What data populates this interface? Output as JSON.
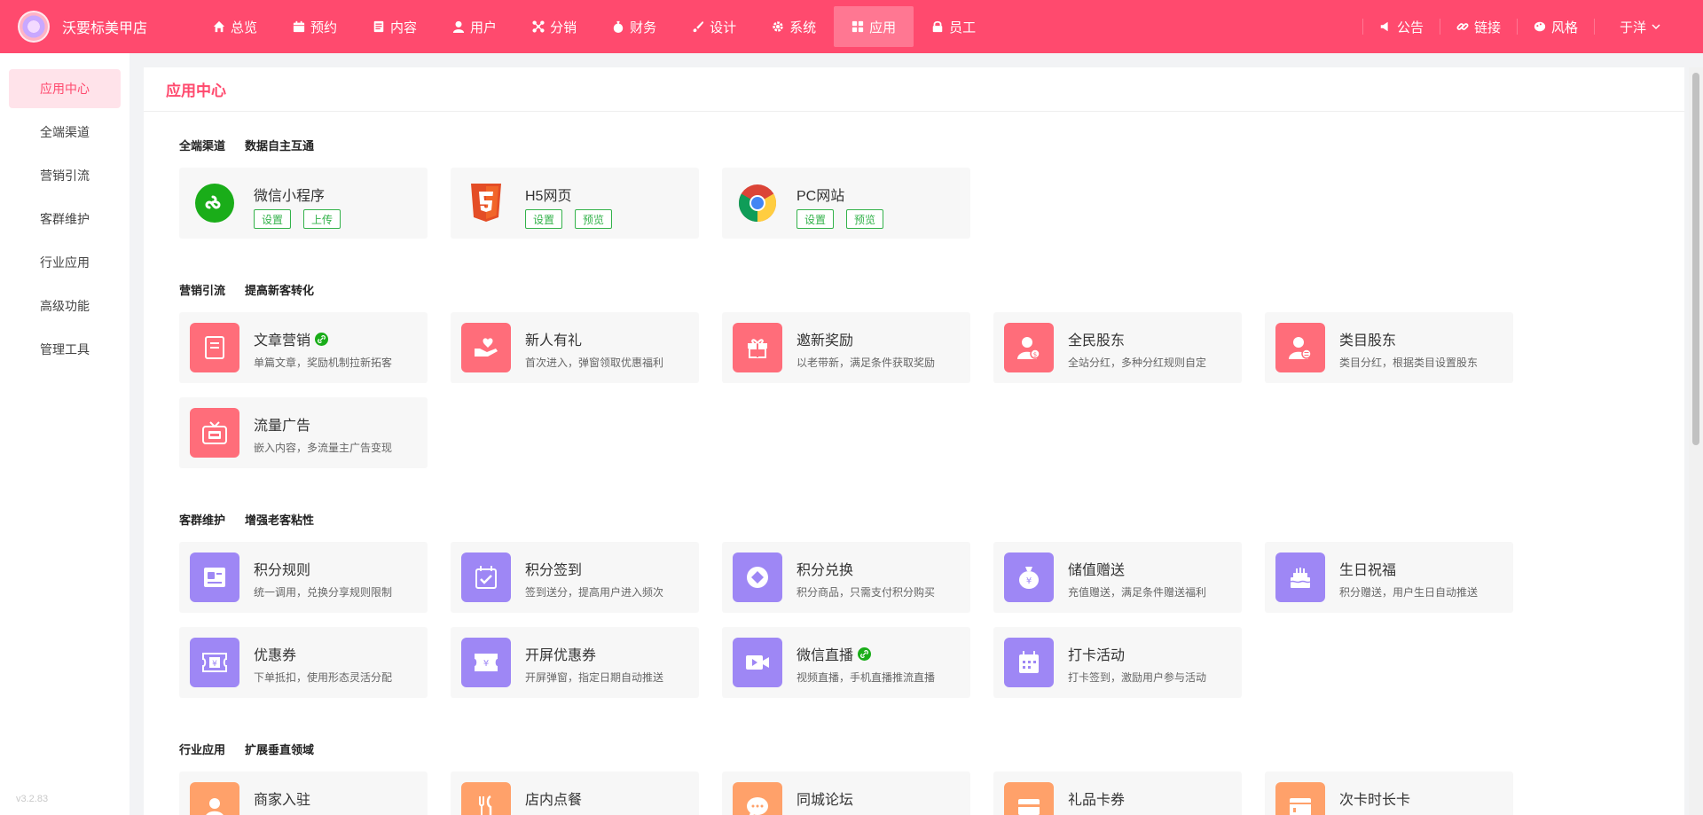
{
  "brand": {
    "name": "沃要标美甲店"
  },
  "nav": [
    {
      "label": "总览",
      "icon": "home-icon"
    },
    {
      "label": "预约",
      "icon": "calendar-icon"
    },
    {
      "label": "内容",
      "icon": "document-icon"
    },
    {
      "label": "用户",
      "icon": "user-icon"
    },
    {
      "label": "分销",
      "icon": "network-icon"
    },
    {
      "label": "财务",
      "icon": "money-bag-icon"
    },
    {
      "label": "设计",
      "icon": "brush-icon"
    },
    {
      "label": "系统",
      "icon": "gear-icon"
    },
    {
      "label": "应用",
      "icon": "grid-icon"
    },
    {
      "label": "员工",
      "icon": "lock-icon"
    }
  ],
  "nav_right": {
    "notice": "公告",
    "link": "链接",
    "style": "风格",
    "user": "于洋"
  },
  "sidebar": {
    "items": [
      {
        "label": "应用中心"
      },
      {
        "label": "全端渠道"
      },
      {
        "label": "营销引流"
      },
      {
        "label": "客群维护"
      },
      {
        "label": "行业应用"
      },
      {
        "label": "高级功能"
      },
      {
        "label": "管理工具"
      }
    ],
    "version": "v3.2.83"
  },
  "page_title": "应用中心",
  "sections": {
    "channel": {
      "title": "全端渠道",
      "subtitle": "数据自主互通",
      "cards": [
        {
          "title": "微信小程序",
          "btn1": "设置",
          "btn2": "上传",
          "icon": "wechat-miniprogram-icon"
        },
        {
          "title": "H5网页",
          "btn1": "设置",
          "btn2": "预览",
          "icon": "html5-icon"
        },
        {
          "title": "PC网站",
          "btn1": "设置",
          "btn2": "预览",
          "icon": "chrome-icon"
        }
      ]
    },
    "marketing": {
      "title": "营销引流",
      "subtitle": "提高新客转化",
      "cards": [
        {
          "title": "文章营销",
          "desc": "单篇文章，奖励机制拉新拓客",
          "icon": "article-icon",
          "link": true
        },
        {
          "title": "新人有礼",
          "desc": "首次进入，弹窗领取优惠福利",
          "icon": "gift-hand-icon"
        },
        {
          "title": "邀新奖励",
          "desc": "以老带新，满足条件获取奖励",
          "icon": "gift-box-icon"
        },
        {
          "title": "全民股东",
          "desc": "全站分红，多种分红规则自定",
          "icon": "shareholder-icon"
        },
        {
          "title": "类目股东",
          "desc": "类目分红，根据类目设置股东",
          "icon": "category-shareholder-icon"
        },
        {
          "title": "流量广告",
          "desc": "嵌入内容，多流量主广告变现",
          "icon": "ad-tv-icon"
        }
      ]
    },
    "retention": {
      "title": "客群维护",
      "subtitle": "增强老客粘性",
      "cards": [
        {
          "title": "积分规则",
          "desc": "统一调用，兑换分享规则限制",
          "icon": "points-rule-icon"
        },
        {
          "title": "积分签到",
          "desc": "签到送分，提高用户进入频次",
          "icon": "checkin-calendar-icon"
        },
        {
          "title": "积分兑换",
          "desc": "积分商品，只需支付积分购买",
          "icon": "exchange-icon"
        },
        {
          "title": "储值赠送",
          "desc": "充值赠送，满足条件赠送福利",
          "icon": "money-bag-icon"
        },
        {
          "title": "生日祝福",
          "desc": "积分赠送，用户生日自动推送",
          "icon": "cake-icon"
        },
        {
          "title": "优惠券",
          "desc": "下单抵扣，使用形态灵活分配",
          "icon": "coupon-icon"
        },
        {
          "title": "开屏优惠券",
          "desc": "开屏弹窗，指定日期自动推送",
          "icon": "splash-coupon-icon"
        },
        {
          "title": "微信直播",
          "desc": "视频直播，手机直播推流直播",
          "icon": "live-video-icon",
          "link": true
        },
        {
          "title": "打卡活动",
          "desc": "打卡签到，激励用户参与活动",
          "icon": "punch-calendar-icon"
        }
      ]
    },
    "industry": {
      "title": "行业应用",
      "subtitle": "扩展垂直领域",
      "cards": [
        {
          "title": "商家入驻",
          "icon": "merchant-icon"
        },
        {
          "title": "店内点餐",
          "icon": "dining-icon"
        },
        {
          "title": "同城论坛",
          "icon": "forum-icon"
        },
        {
          "title": "礼品卡券",
          "icon": "gift-card-icon"
        },
        {
          "title": "次卡时长卡",
          "icon": "time-card-icon"
        }
      ]
    }
  },
  "colors": {
    "brand": "#ff4a6e",
    "marketing_icon": "#ff6d7a",
    "retention_icon": "#9e87f5",
    "industry_icon": "#ffa16a",
    "button_green": "#33b24a"
  }
}
